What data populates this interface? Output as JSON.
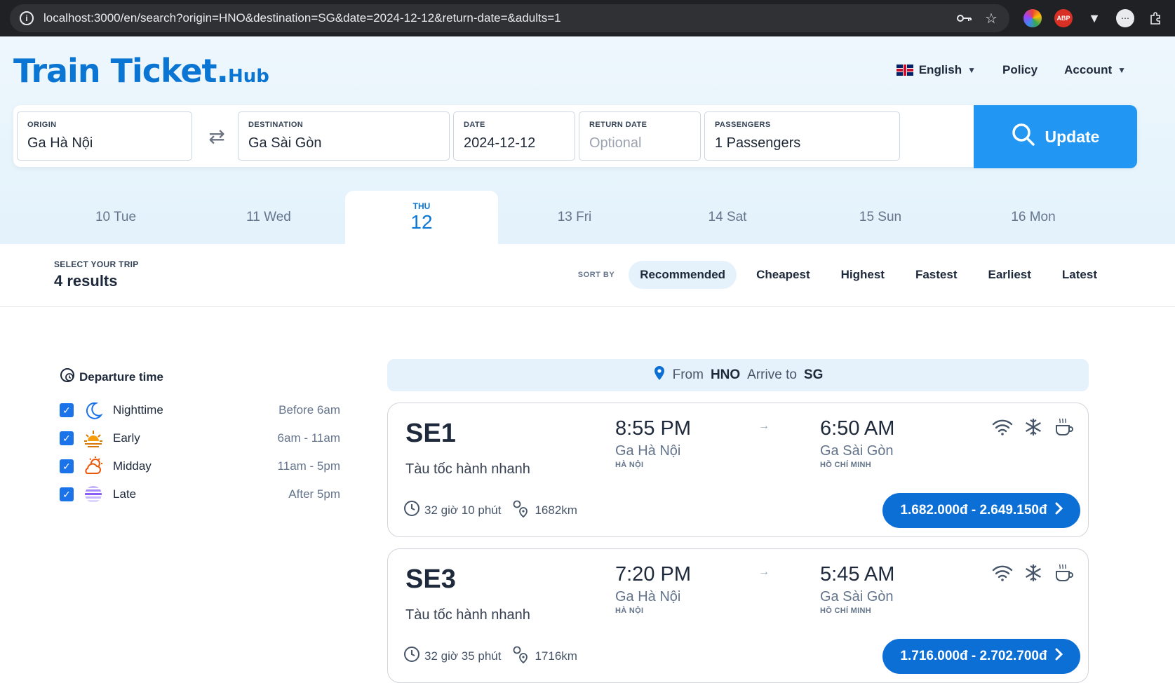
{
  "browser": {
    "url": "localhost:3000/en/search?origin=HNO&destination=SG&date=2024-12-12&return-date=&adults=1",
    "ext_abp": "ABP"
  },
  "header": {
    "logo_main": "Train Ticket.",
    "logo_sub": "Hub",
    "language": "English",
    "policy": "Policy",
    "account": "Account"
  },
  "search": {
    "origin_label": "ORIGIN",
    "origin_value": "Ga Hà Nội",
    "destination_label": "DESTINATION",
    "destination_value": "Ga Sài Gòn",
    "date_label": "DATE",
    "date_value": "2024-12-12",
    "return_label": "RETURN DATE",
    "return_placeholder": "Optional",
    "passengers_label": "PASSENGERS",
    "passengers_value": "1 Passengers",
    "update_label": "Update"
  },
  "days": [
    {
      "label": "10 Tue"
    },
    {
      "label": "11 Wed"
    },
    {
      "dow": "THU",
      "num": "12"
    },
    {
      "label": "13 Fri"
    },
    {
      "label": "14 Sat"
    },
    {
      "label": "15 Sun"
    },
    {
      "label": "16 Mon"
    }
  ],
  "results_bar": {
    "select_label": "SELECT YOUR TRIP",
    "count": "4 results",
    "sort_label": "SORT BY",
    "sort_options": [
      "Recommended",
      "Cheapest",
      "Highest",
      "Fastest",
      "Earliest",
      "Latest"
    ]
  },
  "filters": {
    "title": "Departure time",
    "items": [
      {
        "name": "Nighttime",
        "range": "Before 6am"
      },
      {
        "name": "Early",
        "range": "6am - 11am"
      },
      {
        "name": "Midday",
        "range": "11am - 5pm"
      },
      {
        "name": "Late",
        "range": "After 5pm"
      }
    ]
  },
  "route": {
    "from_label": "From",
    "from_code": "HNO",
    "to_label": "Arrive to",
    "to_code": "SG"
  },
  "trains": [
    {
      "code": "SE1",
      "type": "Tàu tốc hành nhanh",
      "dep_time": "8:55 PM",
      "dep_station": "Ga Hà Nội",
      "dep_city": "HÀ NỘI",
      "arr_time": "6:50 AM",
      "arr_station": "Ga Sài Gòn",
      "arr_city": "HỒ CHÍ MINH",
      "duration": "32 giờ 10 phút",
      "distance": "1682km",
      "price": "1.682.000đ - 2.649.150đ"
    },
    {
      "code": "SE3",
      "type": "Tàu tốc hành nhanh",
      "dep_time": "7:20 PM",
      "dep_station": "Ga Hà Nội",
      "dep_city": "HÀ NỘI",
      "arr_time": "5:45 AM",
      "arr_station": "Ga Sài Gòn",
      "arr_city": "HỒ CHÍ MINH",
      "duration": "32 giờ 35 phút",
      "distance": "1716km",
      "price": "1.716.000đ - 2.702.700đ"
    }
  ],
  "colors": {
    "brand": "#0b75d3",
    "update_button": "#2196f3",
    "price_button": "#0b6fd6"
  }
}
